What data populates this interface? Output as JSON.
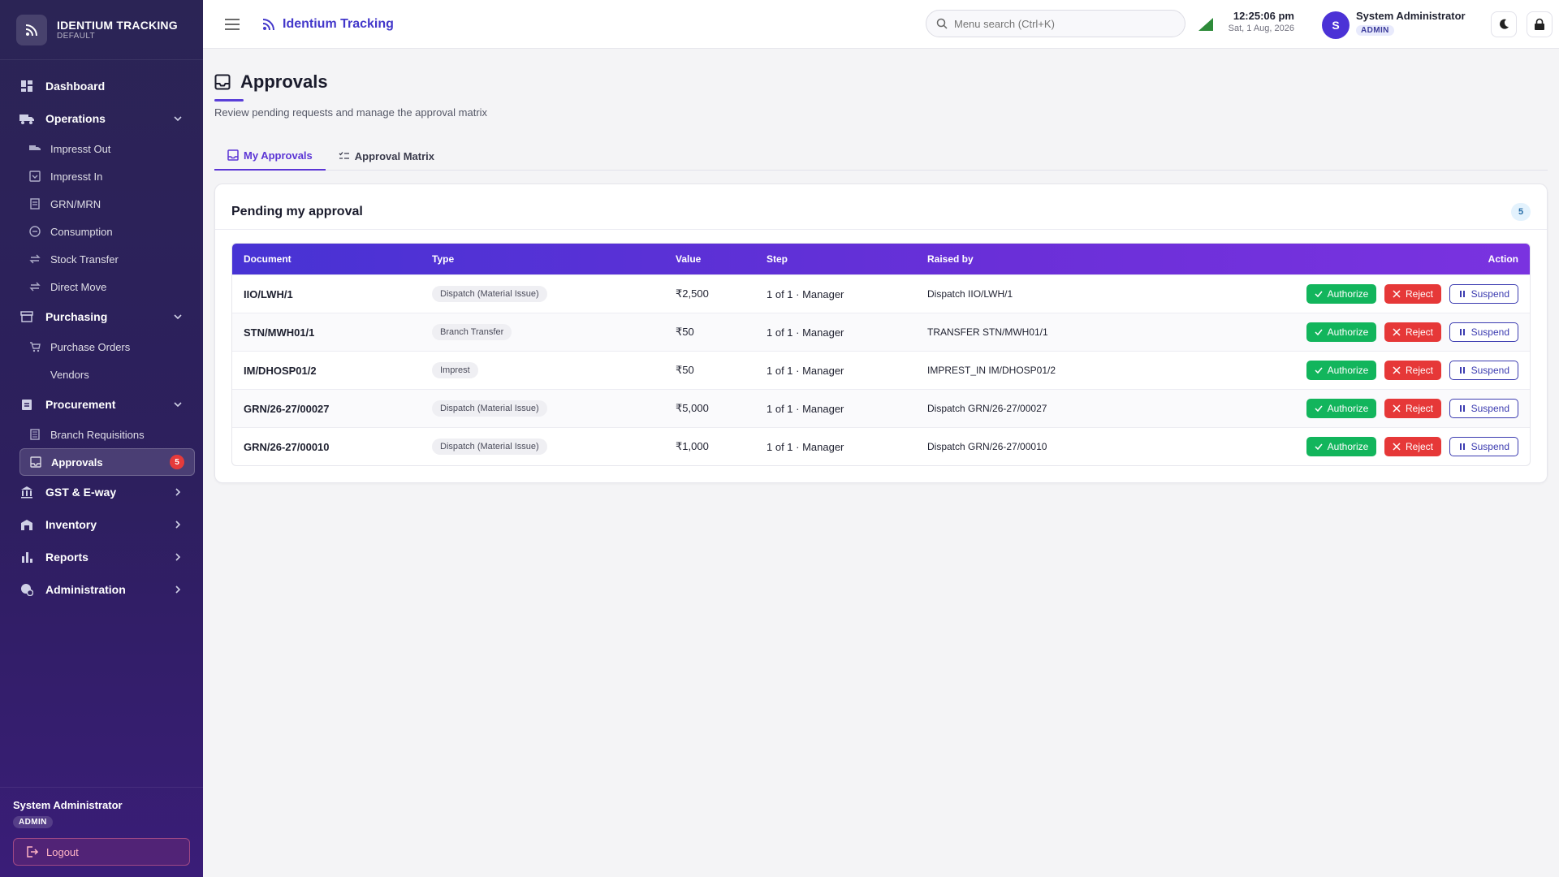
{
  "brand": {
    "name": "IDENTIUM TRACKING",
    "subtitle": "DEFAULT"
  },
  "header": {
    "app_title": "Identium Tracking",
    "search_placeholder": "Menu search (Ctrl+K)",
    "time": "12:25:06 pm",
    "date": "Sat, 1 Aug, 2026",
    "avatar_letter": "S",
    "user_name": "System Administrator",
    "user_role": "ADMIN"
  },
  "sidebar": {
    "dashboard": "Dashboard",
    "operations": {
      "label": "Operations",
      "items": [
        "Impresst Out",
        "Impresst In",
        "GRN/MRN",
        "Consumption",
        "Stock Transfer",
        "Direct Move"
      ]
    },
    "purchasing": {
      "label": "Purchasing",
      "items": [
        "Purchase Orders",
        "Vendors"
      ]
    },
    "procurement": {
      "label": "Procurement",
      "items": [
        "Branch Requisitions",
        "Approvals"
      ],
      "approvals_badge": "5"
    },
    "gst": "GST & E-way",
    "inventory": "Inventory",
    "reports": "Reports",
    "administration": "Administration",
    "footer": {
      "name": "System Administrator",
      "role": "ADMIN",
      "logout": "Logout"
    }
  },
  "page": {
    "title": "Approvals",
    "subtitle": "Review pending requests and manage the approval matrix",
    "tabs": [
      "My Approvals",
      "Approval Matrix"
    ],
    "card_title": "Pending my approval",
    "count": "5"
  },
  "table": {
    "columns": [
      "Document",
      "Type",
      "Value",
      "Step",
      "Raised by",
      "Action"
    ],
    "actions": {
      "authorize": "Authorize",
      "reject": "Reject",
      "suspend": "Suspend"
    },
    "rows": [
      {
        "document": "IIO/LWH/1",
        "type": "Dispatch (Material Issue)",
        "value": "₹2,500",
        "step": "1 of 1 · Manager",
        "raised_by": "Dispatch IIO/LWH/1"
      },
      {
        "document": "STN/MWH01/1",
        "type": "Branch Transfer",
        "value": "₹50",
        "step": "1 of 1 · Manager",
        "raised_by": "TRANSFER STN/MWH01/1"
      },
      {
        "document": "IM/DHOSP01/2",
        "type": "Imprest",
        "value": "₹50",
        "step": "1 of 1 · Manager",
        "raised_by": "IMPREST_IN IM/DHOSP01/2"
      },
      {
        "document": "GRN/26-27/00027",
        "type": "Dispatch (Material Issue)",
        "value": "₹5,000",
        "step": "1 of 1 · Manager",
        "raised_by": "Dispatch GRN/26-27/00027"
      },
      {
        "document": "GRN/26-27/00010",
        "type": "Dispatch (Material Issue)",
        "value": "₹1,000",
        "step": "1 of 1 · Manager",
        "raised_by": "Dispatch GRN/26-27/00010"
      }
    ]
  },
  "colors": {
    "accent": "#5b35d5",
    "authorize": "#12b55c",
    "reject": "#e63838",
    "sidebar": "#2d1f5e"
  }
}
